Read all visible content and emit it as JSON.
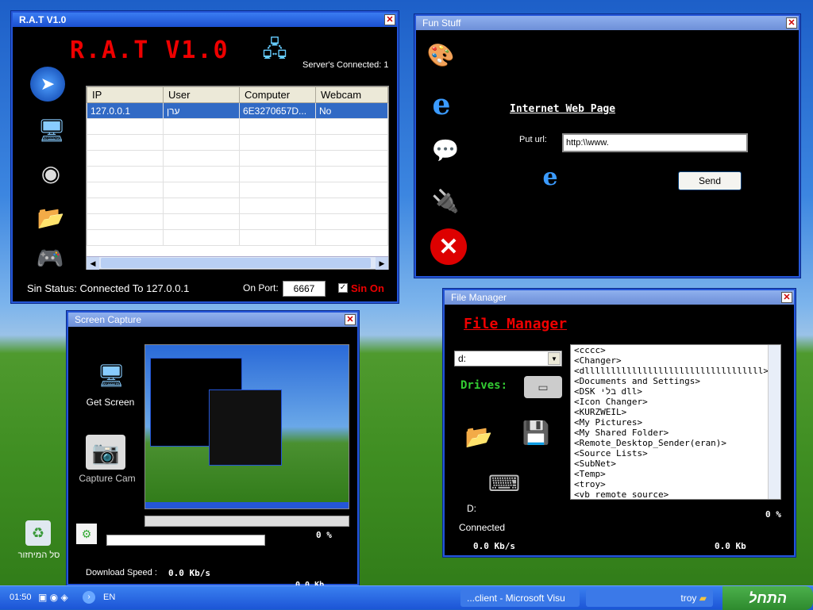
{
  "rat": {
    "window_title": "R.A.T V1.0",
    "logo": "R.A.T V1.0",
    "servers_label": "Server's Connected: 1",
    "columns": [
      "IP",
      "User",
      "Computer",
      "Webcam"
    ],
    "rows": [
      [
        "127.0.0.1",
        "ערן",
        "6E3270657D...",
        "No"
      ]
    ],
    "status": "Sin Status: Connected To 127.0.0.1",
    "port_label": "On Port:",
    "port_value": "6667",
    "sin_on_label": "Sin On"
  },
  "fun": {
    "window_title": "Fun Stuff",
    "heading": "Internet Web Page",
    "url_label": "Put url:",
    "url_value": "http:\\\\www.",
    "send_label": "Send"
  },
  "screen": {
    "window_title": "Screen Capture",
    "get_screen_label": "Get Screen",
    "capture_cam_label": "Capture Cam",
    "percent": "0 %",
    "speed_label": "Download Speed :",
    "speed_value": "0.0 Kb/s",
    "bottom_value": "0.0 Kb"
  },
  "file": {
    "window_title": "File Manager",
    "heading": "File Manager",
    "drive_value": "d:",
    "drives_label": "Drives:",
    "folders": [
      "<cccc>",
      "<Changer>",
      "<dllllllllllllllllllllllllllllllllll>",
      "<Documents and Settings>",
      "<DSK בלי dll>",
      "<Icon Changer>",
      "<KURZWEIL>",
      "<My Pictures>",
      "<My Shared Folder>",
      "<Remote_Desktop_Sender(eran)>",
      "<Source Lists>",
      "<SubNet>",
      "<Temp>",
      "<troy>",
      "<vb remote source>"
    ],
    "path": "D:",
    "status": "Connected",
    "percent": "0 %",
    "speed": "0.0 Kb/s",
    "size": "0.0 Kb"
  },
  "desktop": {
    "recycle_label": "סל המיחזור"
  },
  "taskbar": {
    "clock": "01:50",
    "lang": "EN",
    "task1": "...client - Microsoft Visu",
    "task2": "troy",
    "start_label": "התחל"
  }
}
